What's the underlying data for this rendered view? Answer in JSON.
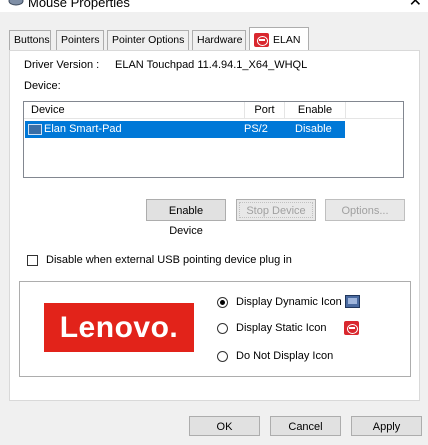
{
  "window": {
    "title": "Mouse Properties",
    "close_glyph": "✕",
    "title_icon": "mouse-icon"
  },
  "tabs": [
    {
      "label": "Buttons"
    },
    {
      "label": "Pointers"
    },
    {
      "label": "Pointer Options"
    },
    {
      "label": "Hardware"
    },
    {
      "label": "ELAN",
      "active": true,
      "icon": "elan-icon"
    }
  ],
  "driver": {
    "label": "Driver Version :",
    "value": "ELAN Touchpad 11.4.94.1_X64_WHQL"
  },
  "device_label": "Device:",
  "device_list": {
    "columns": [
      "Device",
      "Port",
      "Enable"
    ],
    "rows": [
      {
        "device": "Elan Smart-Pad",
        "port": "PS/2",
        "enable": "Disable",
        "selected": true,
        "icon": "touchpad-icon"
      }
    ]
  },
  "actions": {
    "enable_device": "Enable Device",
    "stop_device": "Stop Device",
    "options": "Options..."
  },
  "usb_checkbox": {
    "label": "Disable when external USB pointing device plug in",
    "checked": false
  },
  "brand": {
    "logo_text": "Lenovo.",
    "color": "#e2231a"
  },
  "icon_display": {
    "options": [
      {
        "label": "Display Dynamic Icon",
        "checked": true
      },
      {
        "label": "Display Static Icon",
        "checked": false
      },
      {
        "label": "Do Not Display Icon",
        "checked": false
      }
    ]
  },
  "footer": {
    "ok": "OK",
    "cancel": "Cancel",
    "apply": "Apply"
  },
  "colors": {
    "selection": "#0078d7",
    "elan_red": "#d9272e"
  }
}
